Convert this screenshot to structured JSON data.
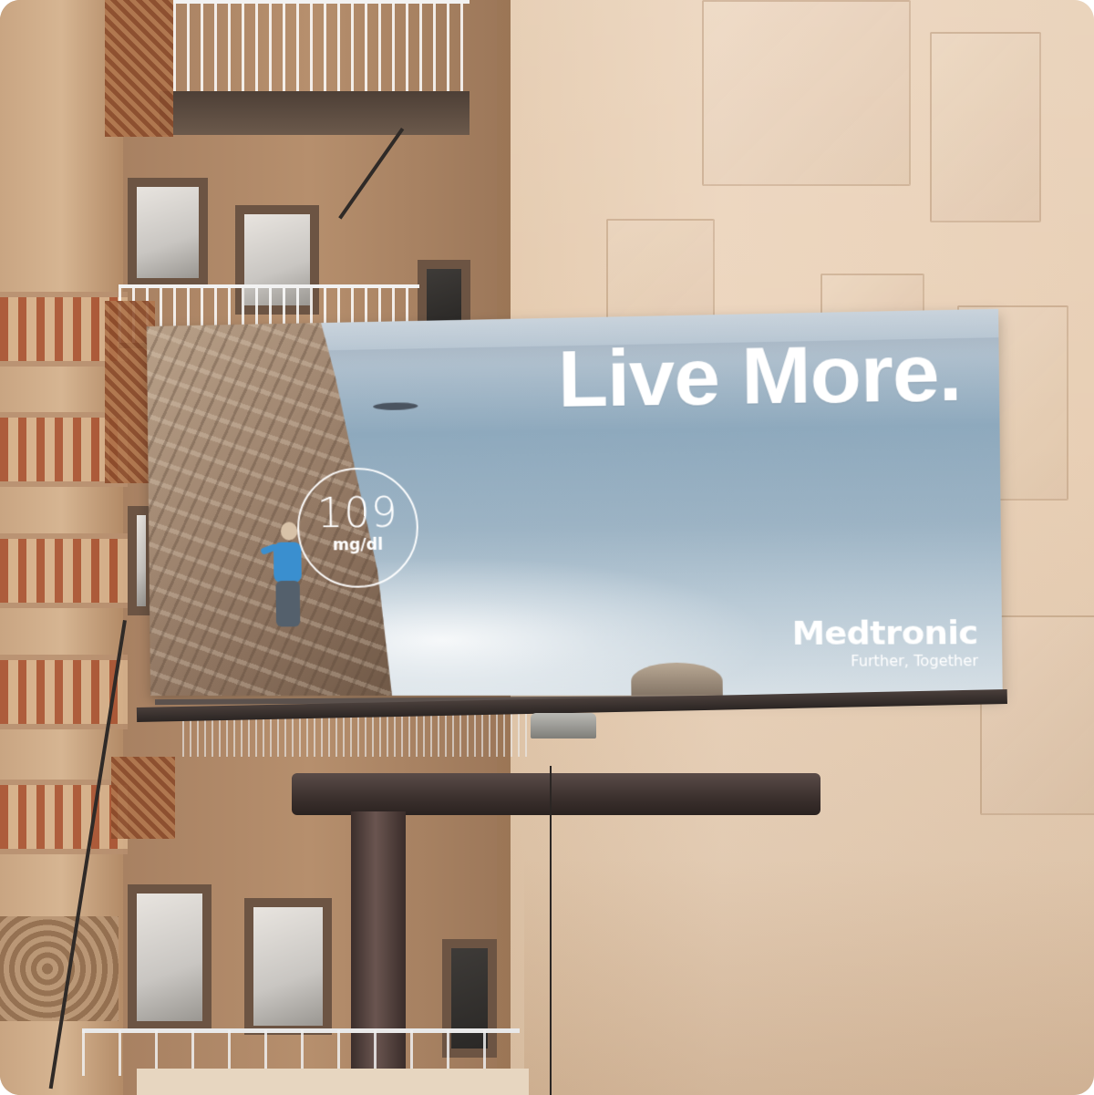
{
  "billboard": {
    "headline": "Live More.",
    "glucose_value": "109",
    "glucose_unit": "mg/dl",
    "brand_name": "Medtronic",
    "brand_tagline": "Further, Together"
  },
  "colors": {
    "wall": "#e8cfb5",
    "sea": "#9cb3c4",
    "text": "#ffffff",
    "climber_shirt": "#3a8fcf",
    "ornament": "#a9502f"
  }
}
